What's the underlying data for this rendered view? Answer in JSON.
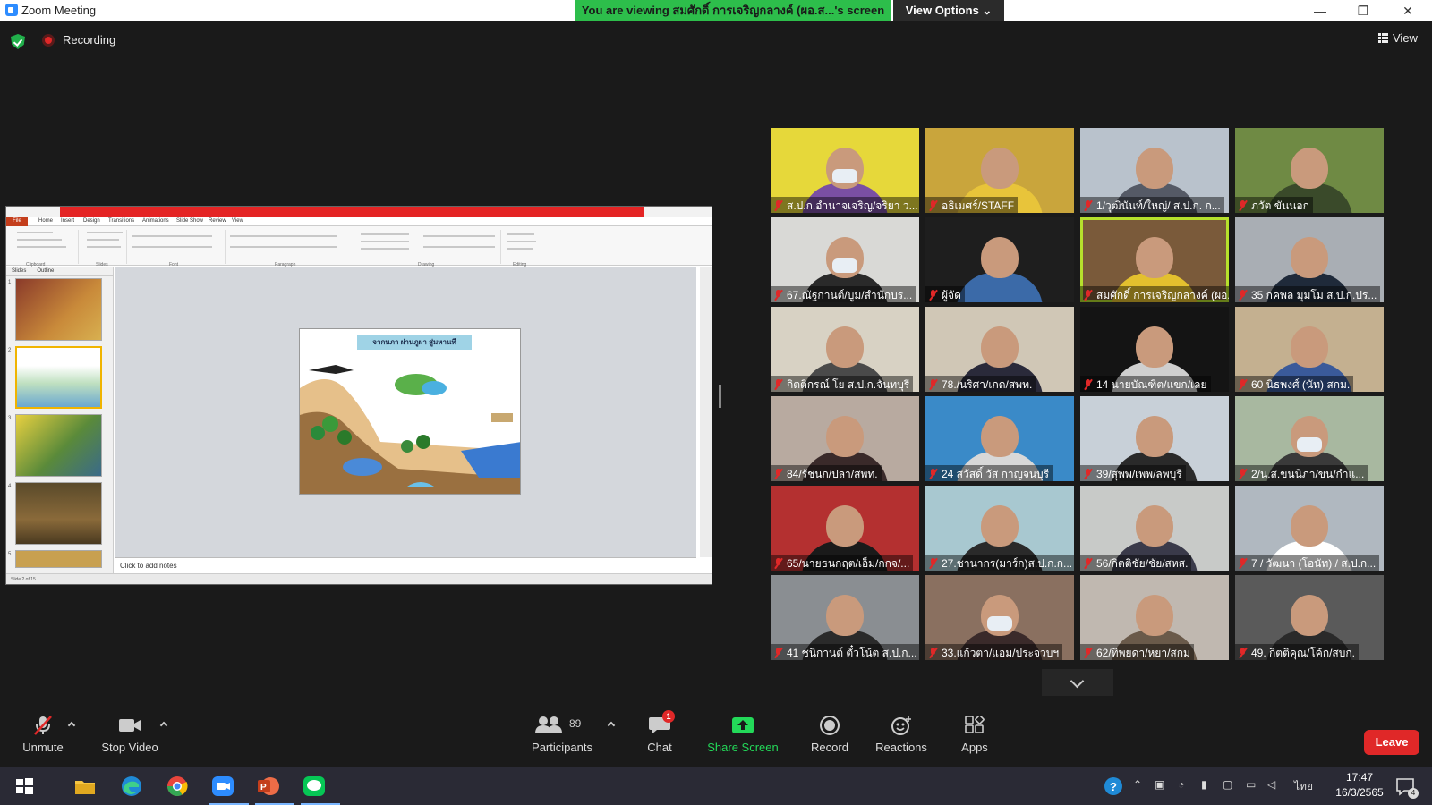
{
  "window": {
    "title": "Zoom Meeting",
    "share_banner": "You are viewing สมศักดิ์ การเจริญกลางค์ (ผอ.ส...'s screen",
    "view_options": "View Options ⌄",
    "minimize": "—",
    "restore": "❐",
    "close": "✕"
  },
  "status": {
    "recording_label": "Recording",
    "view_label": "View"
  },
  "shared_screen": {
    "app": "PowerPoint",
    "ribbon_tabs": [
      "File",
      "Home",
      "Insert",
      "Design",
      "Transitions",
      "Animations",
      "Slide Show",
      "Review",
      "View"
    ],
    "ribbon_groups": [
      "Clipboard",
      "Slides",
      "Font",
      "Paragraph",
      "Drawing",
      "Editing"
    ],
    "left_tabs": [
      "Slides",
      "Outline"
    ],
    "slide_title": "จากนภา ผ่านภูผา สู่มหานที",
    "notes_placeholder": "Click to add notes",
    "status_text": "Slide 2 of 15"
  },
  "participants": [
    {
      "name": "ส.ป.ก.อำนาจเจริญ/จริยา ว...",
      "bg": "#e6d83a",
      "shirt": "#7a4fa3"
    },
    {
      "name": "อธิเมศร์/STAFF",
      "bg": "#c9a53c",
      "shirt": "#e8c43a"
    },
    {
      "name": "1/วุฒินันท์/ใหญ่/ ส.ป.ก. ก...",
      "bg": "#b9c2cc",
      "shirt": "#555a66"
    },
    {
      "name": "ภวัต  ขันนอก",
      "bg": "#6f8a44",
      "shirt": "#3a4a2a"
    },
    {
      "name": "67.ณัฐกานต์/บูม/สำนักบร...",
      "bg": "#d9d9d6",
      "shirt": "#2a2a2a"
    },
    {
      "name": "ผู้จัด",
      "bg": "#1e1e1e",
      "shirt": "#3b6aa8"
    },
    {
      "name": "สมศักดิ์ การเจริญกลางค์ (ผอ...",
      "bg": "#7a5a3a",
      "shirt": "#e3c02e"
    },
    {
      "name": "35 กคพล มุมโม ส.ป.ก.ปร...",
      "bg": "#a9aeb4",
      "shirt": "#1f2a3a"
    },
    {
      "name": "กิตติกรณ์ โย ส.ป.ก.จันทบุรี",
      "bg": "#d8d2c4",
      "shirt": "#4a4a4a"
    },
    {
      "name": "78./นริศา/เกด/สพท.",
      "bg": "#d0c7b6",
      "shirt": "#2a2a3a"
    },
    {
      "name": "14 นายบัณฑิต/แขก/เลย",
      "bg": "#141414",
      "shirt": "#cfcfcf"
    },
    {
      "name": "60 นิธพงศ์ (นัท) สกม.",
      "bg": "#c4b090",
      "shirt": "#3a5a9a"
    },
    {
      "name": "84/รัชนก/ปลา/สพท.",
      "bg": "#b8aaa0",
      "shirt": "#3a2a2a"
    },
    {
      "name": "24 สวัสดิ์ วัส กาญจนบุรี",
      "bg": "#3a8ac8",
      "shirt": "#d8d8d8"
    },
    {
      "name": "39/สุพพ/เพพ/ลพบุรี",
      "bg": "#c8d0d8",
      "shirt": "#2a2a2a"
    },
    {
      "name": "2/น.ส.ขนนิภา/ขน/กำแ...",
      "bg": "#a8b8a0",
      "shirt": "#3a3a3a"
    },
    {
      "name": "65/นายธนกฤต/เอ็ม/กกจ/...",
      "bg": "#b43030",
      "shirt": "#1a1a1a"
    },
    {
      "name": "27.ชานากร(มาร์ก)ส.ป.ก.ก...",
      "bg": "#a8c8d0",
      "shirt": "#2a2a2a"
    },
    {
      "name": "56/กิตติชัย/ชัย/สหส.",
      "bg": "#c8cac8",
      "shirt": "#3a3a4a"
    },
    {
      "name": "7 / วัฒนา (โอนัท) / ส.ป.ก...",
      "bg": "#b0b8c0",
      "shirt": "#ffffff"
    },
    {
      "name": "41 ชนิกานต์ ตั๋วโน้ต ส.ป.ก...",
      "bg": "#8a8e92",
      "shirt": "#2a2a2a"
    },
    {
      "name": "33.แก้วตา/แอม/ประจวบฯ",
      "bg": "#8a7060",
      "shirt": "#3a2a2a"
    },
    {
      "name": "62/ทิพยดา/หยา/สกม",
      "bg": "#c0b8b0",
      "shirt": "#6a5a4a"
    },
    {
      "name": "49. กิตติคุณ/โค้ก/สบก.",
      "bg": "#5a5a5a",
      "shirt": "#2a2a2a"
    }
  ],
  "toolbar": {
    "unmute": "Unmute",
    "stop_video": "Stop Video",
    "participants": "Participants",
    "participants_count": "89",
    "chat": "Chat",
    "chat_badge": "1",
    "share_screen": "Share Screen",
    "record": "Record",
    "reactions": "Reactions",
    "apps": "Apps",
    "leave": "Leave"
  },
  "taskbar": {
    "time": "17:47",
    "date": "16/3/2565",
    "lang": "ไทย",
    "notif_count": "4"
  },
  "colors": {
    "banner": "#2dbe4b",
    "leave": "#e02828",
    "share": "#23d959",
    "active_speaker": "#b6e02c"
  }
}
